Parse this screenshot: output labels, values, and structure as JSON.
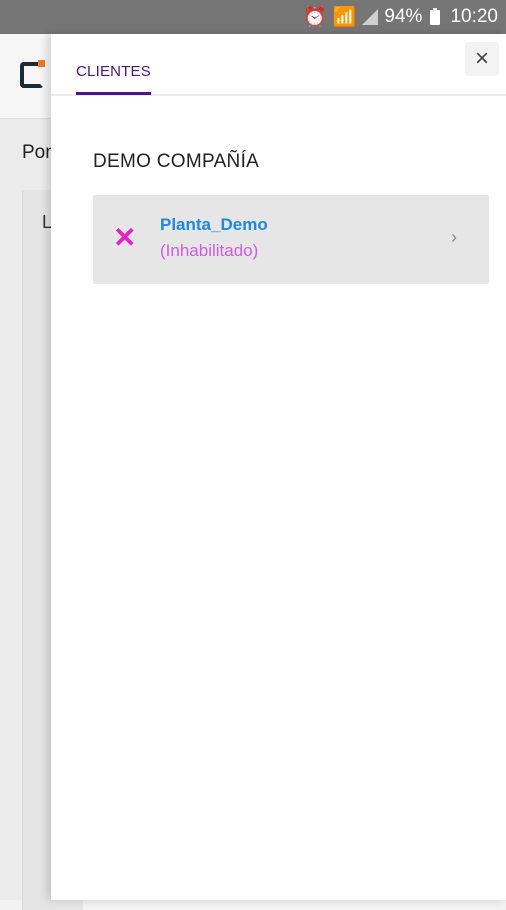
{
  "status_bar": {
    "battery": "94%",
    "time": "10:20",
    "icons": [
      "alarm-icon",
      "wifi-icon",
      "signal-icon",
      "battery-icon"
    ]
  },
  "background": {
    "text1": "Pon",
    "text2": "L"
  },
  "drawer": {
    "tab_label": "CLIENTES",
    "close_label": "×",
    "company_name": "DEMO COMPAÑÍA",
    "clients": [
      {
        "name": "Planta_Demo",
        "state": "(Inhabilitado)",
        "status_icon": "disabled-x-icon"
      }
    ]
  },
  "colors": {
    "accent": "#4a148c",
    "client_name": "#1e88e5",
    "disabled": "#d05ce3",
    "status_bar": "#757575"
  }
}
